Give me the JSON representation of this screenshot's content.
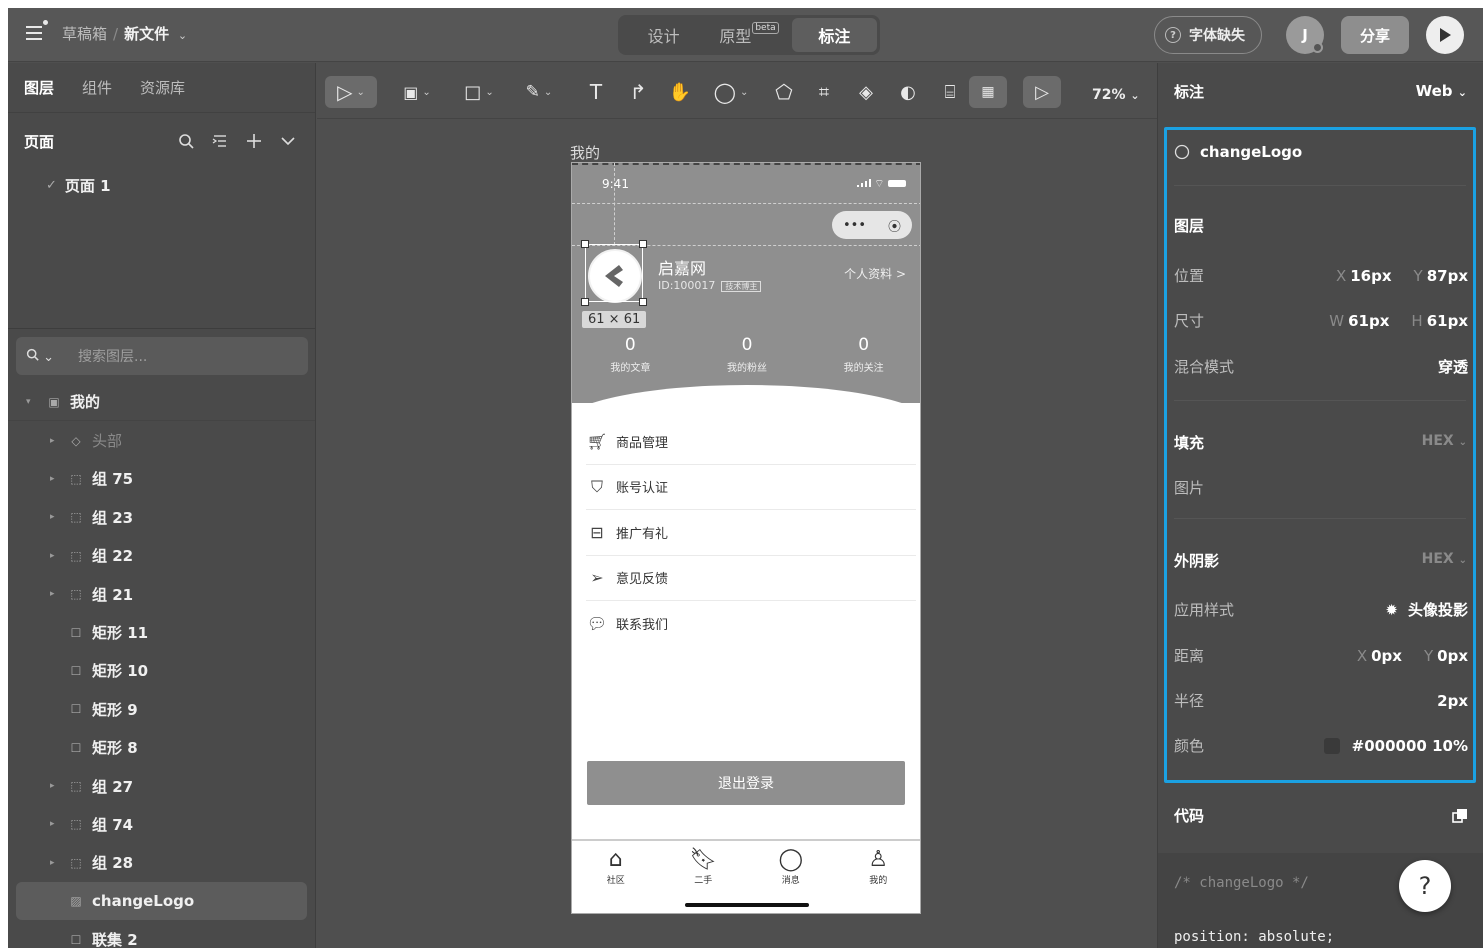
{
  "header": {
    "breadcrumb_parent": "草稿箱",
    "breadcrumb_sep": "/",
    "file_name": "新文件",
    "mode_tabs": [
      "设计",
      "原型",
      "标注"
    ],
    "beta_badge": "beta",
    "font_missing": "字体缺失",
    "avatar_letter": "J",
    "share": "分享"
  },
  "left": {
    "tabs": [
      "图层",
      "组件",
      "资源库"
    ],
    "pages_title": "页面",
    "pages": [
      "页面 1"
    ],
    "search_placeholder": "搜索图层...",
    "layers": [
      {
        "name": "我的",
        "icon": "frame-icon",
        "depth": 0,
        "expanded": true,
        "dim": false
      },
      {
        "name": "头部",
        "icon": "component-icon",
        "depth": 1,
        "expanded": false,
        "dim": true
      },
      {
        "name": "组 75",
        "icon": "group-icon",
        "depth": 1,
        "expanded": false,
        "dim": false
      },
      {
        "name": "组 23",
        "icon": "group-icon",
        "depth": 1,
        "expanded": false,
        "dim": false
      },
      {
        "name": "组 22",
        "icon": "group-icon",
        "depth": 1,
        "expanded": false,
        "dim": false
      },
      {
        "name": "组 21",
        "icon": "group-icon",
        "depth": 1,
        "expanded": false,
        "dim": false
      },
      {
        "name": "矩形 11",
        "icon": "rect-icon",
        "depth": 1,
        "expanded": null,
        "dim": false
      },
      {
        "name": "矩形 10",
        "icon": "rect-icon",
        "depth": 1,
        "expanded": null,
        "dim": false
      },
      {
        "name": "矩形 9",
        "icon": "rect-icon",
        "depth": 1,
        "expanded": null,
        "dim": false
      },
      {
        "name": "矩形 8",
        "icon": "rect-icon",
        "depth": 1,
        "expanded": null,
        "dim": false
      },
      {
        "name": "组 27",
        "icon": "group-icon",
        "depth": 1,
        "expanded": false,
        "dim": false
      },
      {
        "name": "组 74",
        "icon": "group-icon",
        "depth": 1,
        "expanded": false,
        "dim": false
      },
      {
        "name": "组 28",
        "icon": "group-icon",
        "depth": 1,
        "expanded": false,
        "dim": false
      },
      {
        "name": "changeLogo",
        "icon": "image-icon",
        "depth": 1,
        "expanded": null,
        "dim": false,
        "selected": true
      },
      {
        "name": "联集 2",
        "icon": "rect-icon",
        "depth": 1,
        "expanded": null,
        "dim": false
      }
    ]
  },
  "toolbar": {
    "zoom": "72%"
  },
  "canvas": {
    "frame_label": "我的",
    "status_time": "9:41",
    "user_name": "启嘉网",
    "user_id": "ID:100017",
    "user_tag": "技术博主",
    "profile_link": "个人资料 >",
    "selection_size": "61 × 61",
    "stats": [
      {
        "n": "0",
        "l": "我的文章"
      },
      {
        "n": "0",
        "l": "我的粉丝"
      },
      {
        "n": "0",
        "l": "我的关注"
      }
    ],
    "menu": [
      {
        "label": "商品管理",
        "icon": "cart-icon"
      },
      {
        "label": "账号认证",
        "icon": "shield-icon"
      },
      {
        "label": "推广有礼",
        "icon": "gift-icon"
      },
      {
        "label": "意见反馈",
        "icon": "send-icon"
      },
      {
        "label": "联系我们",
        "icon": "chat-icon"
      }
    ],
    "logout": "退出登录",
    "tabbar": [
      {
        "label": "社区",
        "icon": "home-icon"
      },
      {
        "label": "二手",
        "icon": "bookmark-icon"
      },
      {
        "label": "消息",
        "icon": "message-icon"
      },
      {
        "label": "我的",
        "icon": "user-icon"
      }
    ]
  },
  "inspector": {
    "title": "标注",
    "platform": "Web",
    "layer_name": "changeLogo",
    "layer_section": "图层",
    "position_label": "位置",
    "x_key": "X",
    "x_val": "16px",
    "y_key": "Y",
    "y_val": "87px",
    "size_label": "尺寸",
    "w_key": "W",
    "w_val": "61px",
    "h_key": "H",
    "h_val": "61px",
    "blend_label": "混合模式",
    "blend_val": "穿透",
    "fill_section": "填充",
    "fill_format": "HEX",
    "fill_type": "图片",
    "shadow_section": "外阴影",
    "shadow_format": "HEX",
    "style_label": "应用样式",
    "style_val": "头像投影",
    "distance_label": "距离",
    "dx_key": "X",
    "dx_val": "0px",
    "dy_key": "Y",
    "dy_val": "0px",
    "radius_label": "半径",
    "radius_val": "2px",
    "color_label": "颜色",
    "color_val": "#000000 10%",
    "code_title": "代码",
    "code_comment": "/* changeLogo */",
    "code_line": "position: absolute;"
  },
  "colors": {
    "accent_outline": "#1ba1e2"
  }
}
